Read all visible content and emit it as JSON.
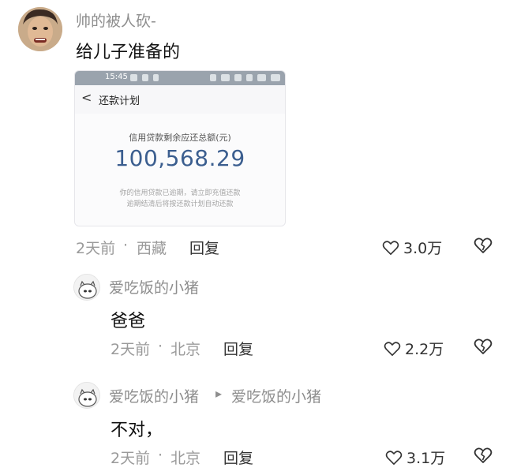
{
  "top_comment": {
    "username": "帅的被人砍-",
    "text": "给儿子准备的",
    "time": "2天前",
    "separator": "·",
    "location": "西藏",
    "reply_label": "回复",
    "likes": "3.0万",
    "screenshot": {
      "status_time": "15:45",
      "back_glyph": "<",
      "page_title": "还款计划",
      "balance_label": "信用贷款剩余应还总额(元)",
      "balance_amount": "100,568.29",
      "note_line1": "你的信用贷款已逾期，请立即充值还款",
      "note_line2": "逾期结清后将按还款计划自动还款"
    }
  },
  "replies": [
    {
      "username": "爱吃饭的小猪",
      "text": "爸爸",
      "time": "2天前",
      "separator": "·",
      "location": "北京",
      "reply_label": "回复",
      "likes": "2.2万"
    },
    {
      "username": "爱吃饭的小猪",
      "reply_to_arrow": "▸",
      "reply_to": "爱吃饭的小猪",
      "text": "不对，",
      "time": "2天前",
      "separator": "·",
      "location": "北京",
      "reply_label": "回复",
      "likes": "3.1万"
    }
  ],
  "icons": {
    "like": "heart-outline-icon",
    "dislike": "broken-heart-icon"
  }
}
